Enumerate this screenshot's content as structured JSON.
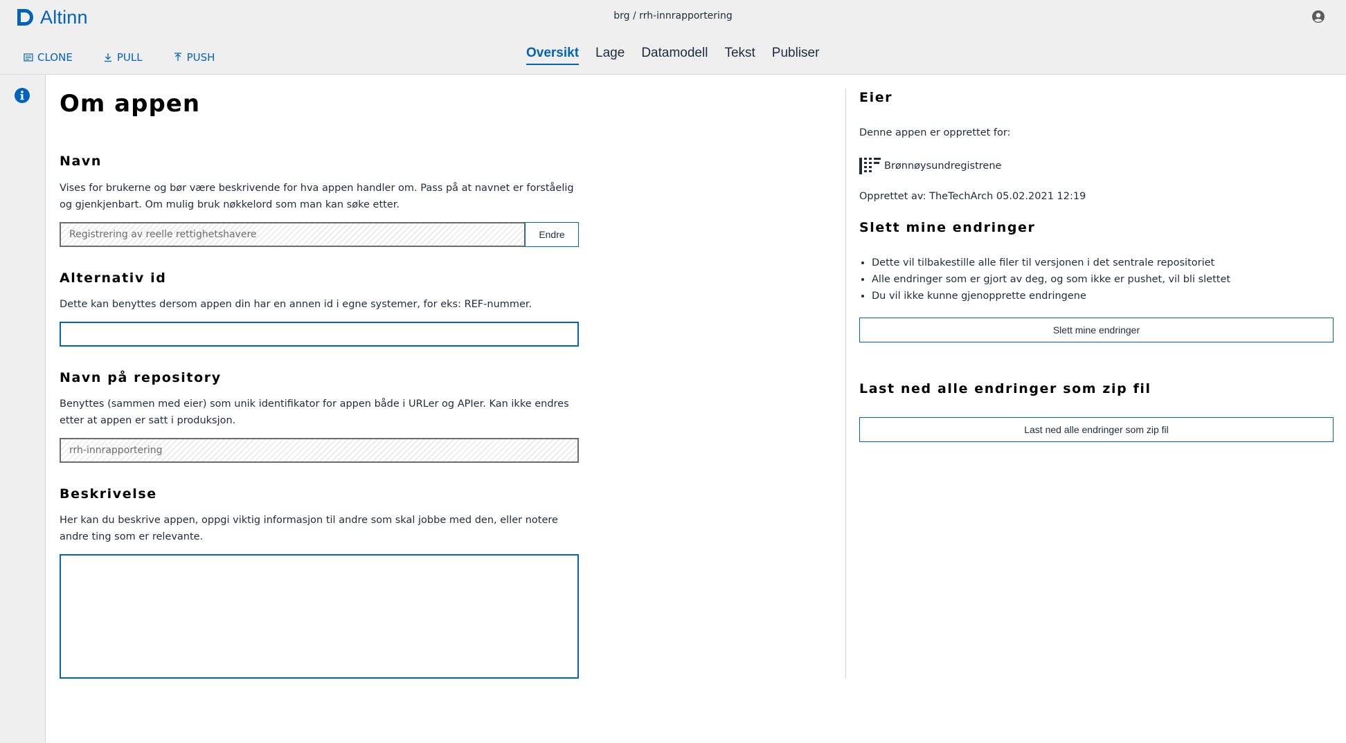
{
  "header": {
    "logo_text": "Altinn",
    "breadcrumb": "brg / rrh-innrapportering",
    "toolbar": [
      {
        "label": "CLONE",
        "icon": "clone-icon"
      },
      {
        "label": "PULL",
        "icon": "download-icon"
      },
      {
        "label": "PUSH",
        "icon": "upload-icon"
      }
    ],
    "tabs": [
      {
        "label": "Oversikt",
        "active": true
      },
      {
        "label": "Lage",
        "active": false
      },
      {
        "label": "Datamodell",
        "active": false
      },
      {
        "label": "Tekst",
        "active": false
      },
      {
        "label": "Publiser",
        "active": false
      }
    ],
    "user_icon": "user-circle-icon"
  },
  "main": {
    "title": "Om appen",
    "navn": {
      "heading": "Navn",
      "description": "Vises for brukerne og bør være beskrivende for hva appen handler om. Pass på at navnet er forståelig og gjenkjenbart. Om mulig bruk nøkkelord som man kan søke etter.",
      "value": "Registrering av reelle rettighetshavere",
      "button": "Endre"
    },
    "alternativ_id": {
      "heading": "Alternativ id",
      "description": "Dette kan benyttes dersom appen din har en annen id i egne systemer, for eks: REF-nummer.",
      "value": ""
    },
    "repository": {
      "heading": "Navn på repository",
      "description": "Benyttes (sammen med eier) som unik identifikator for appen både i URLer og APIer. Kan ikke endres etter at appen er satt i produksjon.",
      "value": "rrh-innrapportering"
    },
    "beskrivelse": {
      "heading": "Beskrivelse",
      "description": "Her kan du beskrive appen, oppgi viktig informasjon til andre som skal jobbe med den, eller notere andre ting som er relevante.",
      "value": ""
    }
  },
  "side": {
    "eier_heading": "Eier",
    "created_for_label": "Denne appen er opprettet for:",
    "org_name": "Brønnøysundregistrene",
    "created_by": "Opprettet av: TheTechArch 05.02.2021 12:19",
    "slett_heading": "Slett mine endringer",
    "slett_bullets": [
      "Dette vil tilbakestille alle filer til versjonen i det sentrale repositoriet",
      "Alle endringer som er gjort av deg, og som ikke er pushet, vil bli slettet",
      "Du vil ikke kunne gjenopprette endringene"
    ],
    "slett_button": "Slett mine endringer",
    "download_heading": "Last ned alle endringer som zip fil",
    "download_button": "Last ned alle endringer som zip fil"
  },
  "colors": {
    "accent": "#0062ba",
    "header_bg": "#efefef"
  }
}
